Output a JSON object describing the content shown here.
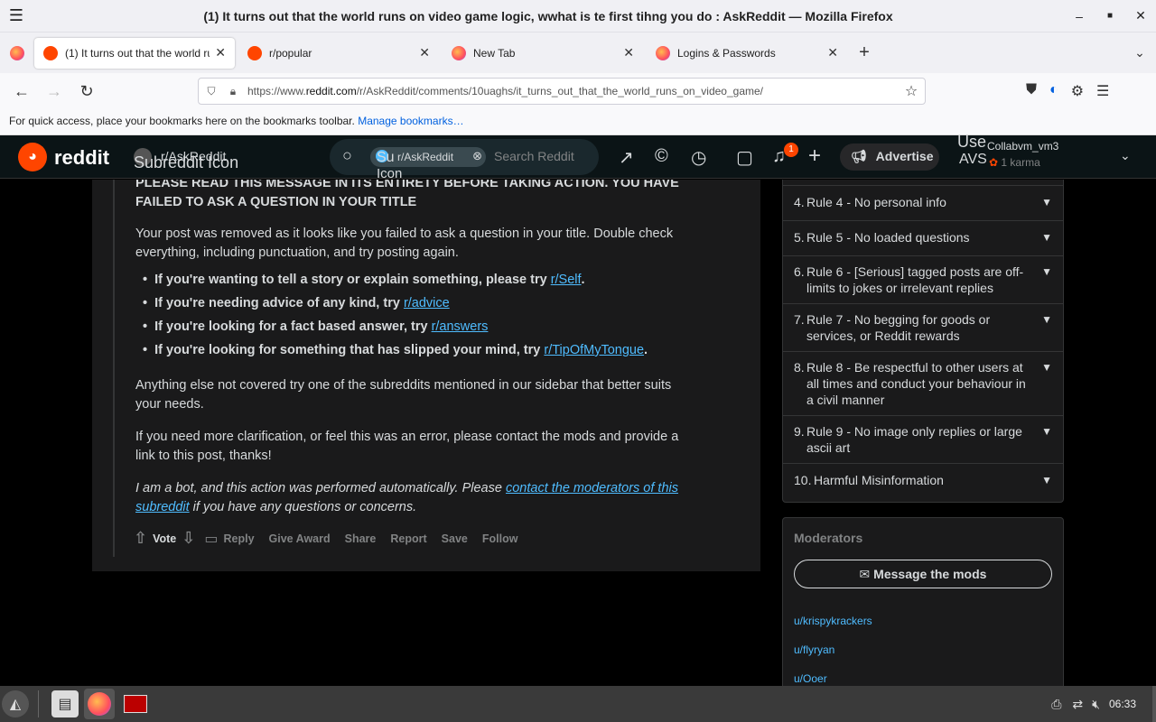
{
  "window": {
    "title": "(1) It turns out that the world runs on video game logic, wwhat is te first tihng you do : AskReddit — Mozilla Firefox"
  },
  "tabs": [
    {
      "label": "(1) It turns out that the world runs on video game logic",
      "icon": "reddit-icon",
      "active": true
    },
    {
      "label": "r/popular",
      "icon": "reddit-icon",
      "active": false
    },
    {
      "label": "New Tab",
      "icon": "firefox-icon",
      "active": false
    },
    {
      "label": "Logins & Passwords",
      "icon": "firefox-icon",
      "active": false
    }
  ],
  "urlbar": {
    "prefix": "https://www.",
    "domain": "reddit.com",
    "path": "/r/AskReddit/comments/10uaghs/it_turns_out_that_the_world_runs_on_video_game/"
  },
  "bookmarks": {
    "text": "For quick access, place your bookmarks here on the bookmarks toolbar.",
    "link": "Manage bookmarks…"
  },
  "reddit_header": {
    "logo": "reddit",
    "subreddit": "r/AskReddit",
    "subreddit_icon_alt": "Subreddit Icon",
    "search_chip": "r/AskReddit",
    "search_chip_alt_1": "Su",
    "search_chip_alt_2": "Icon",
    "search_placeholder": "Search Reddit",
    "notification_count": "1",
    "advertise": "Advertise",
    "user_alt": "Use",
    "user_alt2": "AVS",
    "username": "Collabvm_vm3",
    "karma": "1 karma"
  },
  "comment": {
    "heading": "PLEASE READ THIS MESSAGE IN ITS ENTIRETY BEFORE TAKING ACTION. YOU HAVE FAILED TO ASK A QUESTION IN YOUR TITLE",
    "para1": "Your post was removed as it looks like you failed to ask a question in your title. Double check everything, including punctuation, and try posting again.",
    "bullets": [
      {
        "text": "If you're wanting to tell a story or explain something, please try ",
        "link": "r/Self",
        "after": "."
      },
      {
        "text": "If you're needing advice of any kind, try ",
        "link": "r/advice",
        "after": ""
      },
      {
        "text": "If you're looking for a fact based answer, try ",
        "link": "r/answers",
        "after": ""
      },
      {
        "text": "If you're looking for something that has slipped your mind, try ",
        "link": "r/TipOfMyTongue",
        "after": "."
      }
    ],
    "para2": "Anything else not covered try one of the subreddits mentioned in our sidebar that better suits your needs.",
    "para3": "If you need more clarification, or feel this was an error, please contact the mods and provide a link to this post, thanks!",
    "bot_pre": "I am a bot, and this action was performed automatically. Please ",
    "bot_link": "contact the moderators of this subreddit",
    "bot_post": " if you have any questions or concerns.",
    "actions": {
      "vote": "Vote",
      "reply": "Reply",
      "give_award": "Give Award",
      "share": "Share",
      "report": "Report",
      "save": "Save",
      "follow": "Follow"
    }
  },
  "rules": [
    {
      "num": "4.",
      "text": "Rule 4 - No personal info"
    },
    {
      "num": "5.",
      "text": "Rule 5 - No loaded questions"
    },
    {
      "num": "6.",
      "text": "Rule 6 - [Serious] tagged posts are off-limits to jokes or irrelevant replies"
    },
    {
      "num": "7.",
      "text": "Rule 7 - No begging for goods or services, or Reddit rewards"
    },
    {
      "num": "8.",
      "text": "Rule 8 - Be respectful to other users at all times and conduct your behaviour in a civil manner"
    },
    {
      "num": "9.",
      "text": "Rule 9 - No image only replies or large ascii art"
    },
    {
      "num": "10.",
      "text": "Harmful Misinformation"
    }
  ],
  "moderators": {
    "title": "Moderators",
    "message_button": "Message the mods",
    "list": [
      "u/krispykrackers",
      "u/flyryan",
      "u/Ooer"
    ]
  },
  "taskbar": {
    "clock": "06:33"
  },
  "colors": {
    "reddit_orange": "#ff4500",
    "link_blue": "#4fbcff",
    "comment_bg": "#1a1a1b",
    "header_bg": "#0b1416"
  }
}
